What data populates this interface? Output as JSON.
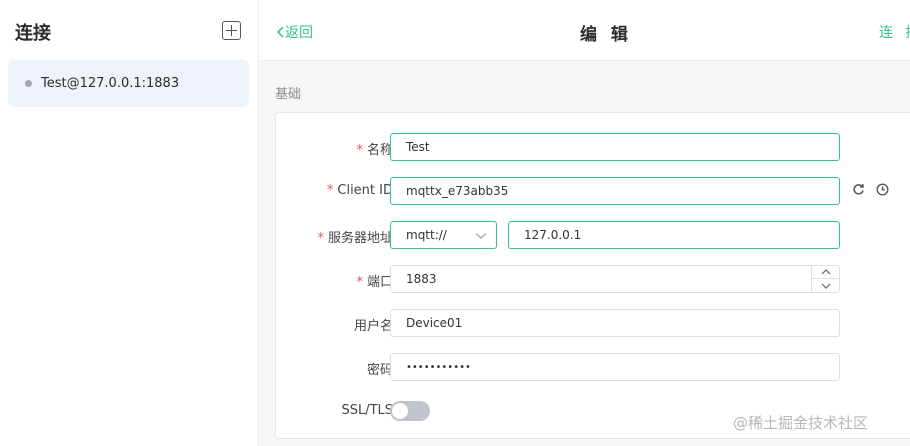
{
  "sidebar": {
    "title": "连接",
    "add_button_icon": "plus-square-icon",
    "connections": [
      {
        "label": "Test@127.0.0.1:1883",
        "status_color": "#a2a6ad"
      }
    ]
  },
  "topbar": {
    "back_label": "返回",
    "title": "编 辑",
    "connect_label": "连 接"
  },
  "section": {
    "title": "基础"
  },
  "form": {
    "name": {
      "label": "名称",
      "required": "*",
      "value": "Test"
    },
    "client_id": {
      "label": "Client ID",
      "required": "*",
      "value": "mqttx_e73abb35",
      "refresh_icon": "refresh-icon",
      "history_icon": "clock-icon"
    },
    "host": {
      "label": "服务器地址",
      "required": "*",
      "protocol": "mqtt://",
      "value": "127.0.0.1"
    },
    "port": {
      "label": "端口",
      "required": "*",
      "value": "1883"
    },
    "username": {
      "label": "用户名",
      "value": "Device01"
    },
    "password": {
      "label": "密码",
      "value": "•••••••••••"
    },
    "ssl": {
      "label": "SSL/TLS",
      "enabled": false
    }
  },
  "watermark": "@稀土掘金技术社区",
  "colors": {
    "accent": "#34c388",
    "required": "#e84e4e"
  }
}
